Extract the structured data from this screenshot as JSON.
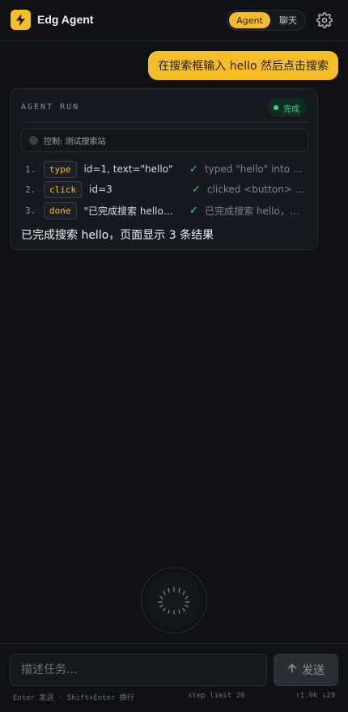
{
  "header": {
    "title": "Edg Agent",
    "mode_agent": "Agent",
    "mode_chat": "聊天",
    "active_mode": "Agent",
    "icons": {
      "logo": "lightning-bolt-icon",
      "settings": "gear-icon"
    }
  },
  "conversation": {
    "user_message": "在搜索框输入 hello 然后点击搜索"
  },
  "run": {
    "title": "AGENT RUN",
    "status": "完成",
    "control_label": "控制: 测试搜索站",
    "steps": [
      {
        "num": "1.",
        "tool": "type",
        "args": "id=1, text=\"hello\"",
        "check": "✓",
        "result": "typed \"hello\" into <i…"
      },
      {
        "num": "2.",
        "tool": "click",
        "args": "id=3",
        "check": "✓",
        "result": "clicked <button> \"…"
      },
      {
        "num": "3.",
        "tool": "done",
        "args": "\"已完成搜索 hello，…",
        "check": "✓",
        "result": "已完成搜索 hello，…"
      }
    ],
    "final_answer": "已完成搜索 hello，页面显示 3 条结果"
  },
  "composer": {
    "placeholder": "描述任务...",
    "value": "",
    "send_label": "发送",
    "hint_keys": "Enter 发送 · Shift+Enter 换行",
    "step_limit": "step limit 20",
    "tokens": "↑1.9k ↓29"
  },
  "colors": {
    "accent": "#f6bd27",
    "success": "#3fd48c",
    "background": "#0f1115"
  }
}
